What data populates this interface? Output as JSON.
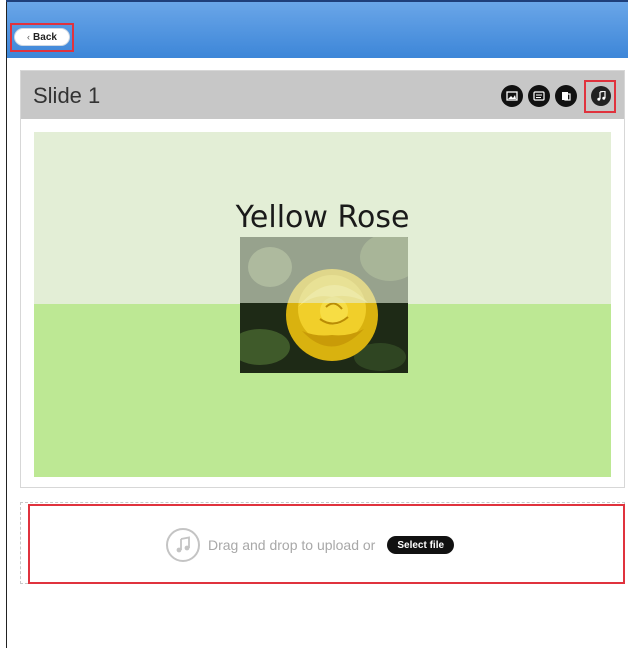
{
  "header": {
    "back_label": "Back",
    "back_chevron": "‹"
  },
  "slide_panel": {
    "title": "Slide 1",
    "tools": [
      "image-icon",
      "text-icon",
      "layout-icon",
      "music-note-icon"
    ],
    "slide": {
      "heading": "Yellow Rose"
    }
  },
  "upload": {
    "icon": "music-note-icon",
    "text": "Drag and drop to upload or",
    "select_label": "Select file"
  },
  "colors": {
    "header_top": "#6aa6e8",
    "header_bottom": "#3d86d8",
    "highlight": "#e0323d",
    "slide_green": "#bde894",
    "slide_top": "#e3eed6"
  }
}
